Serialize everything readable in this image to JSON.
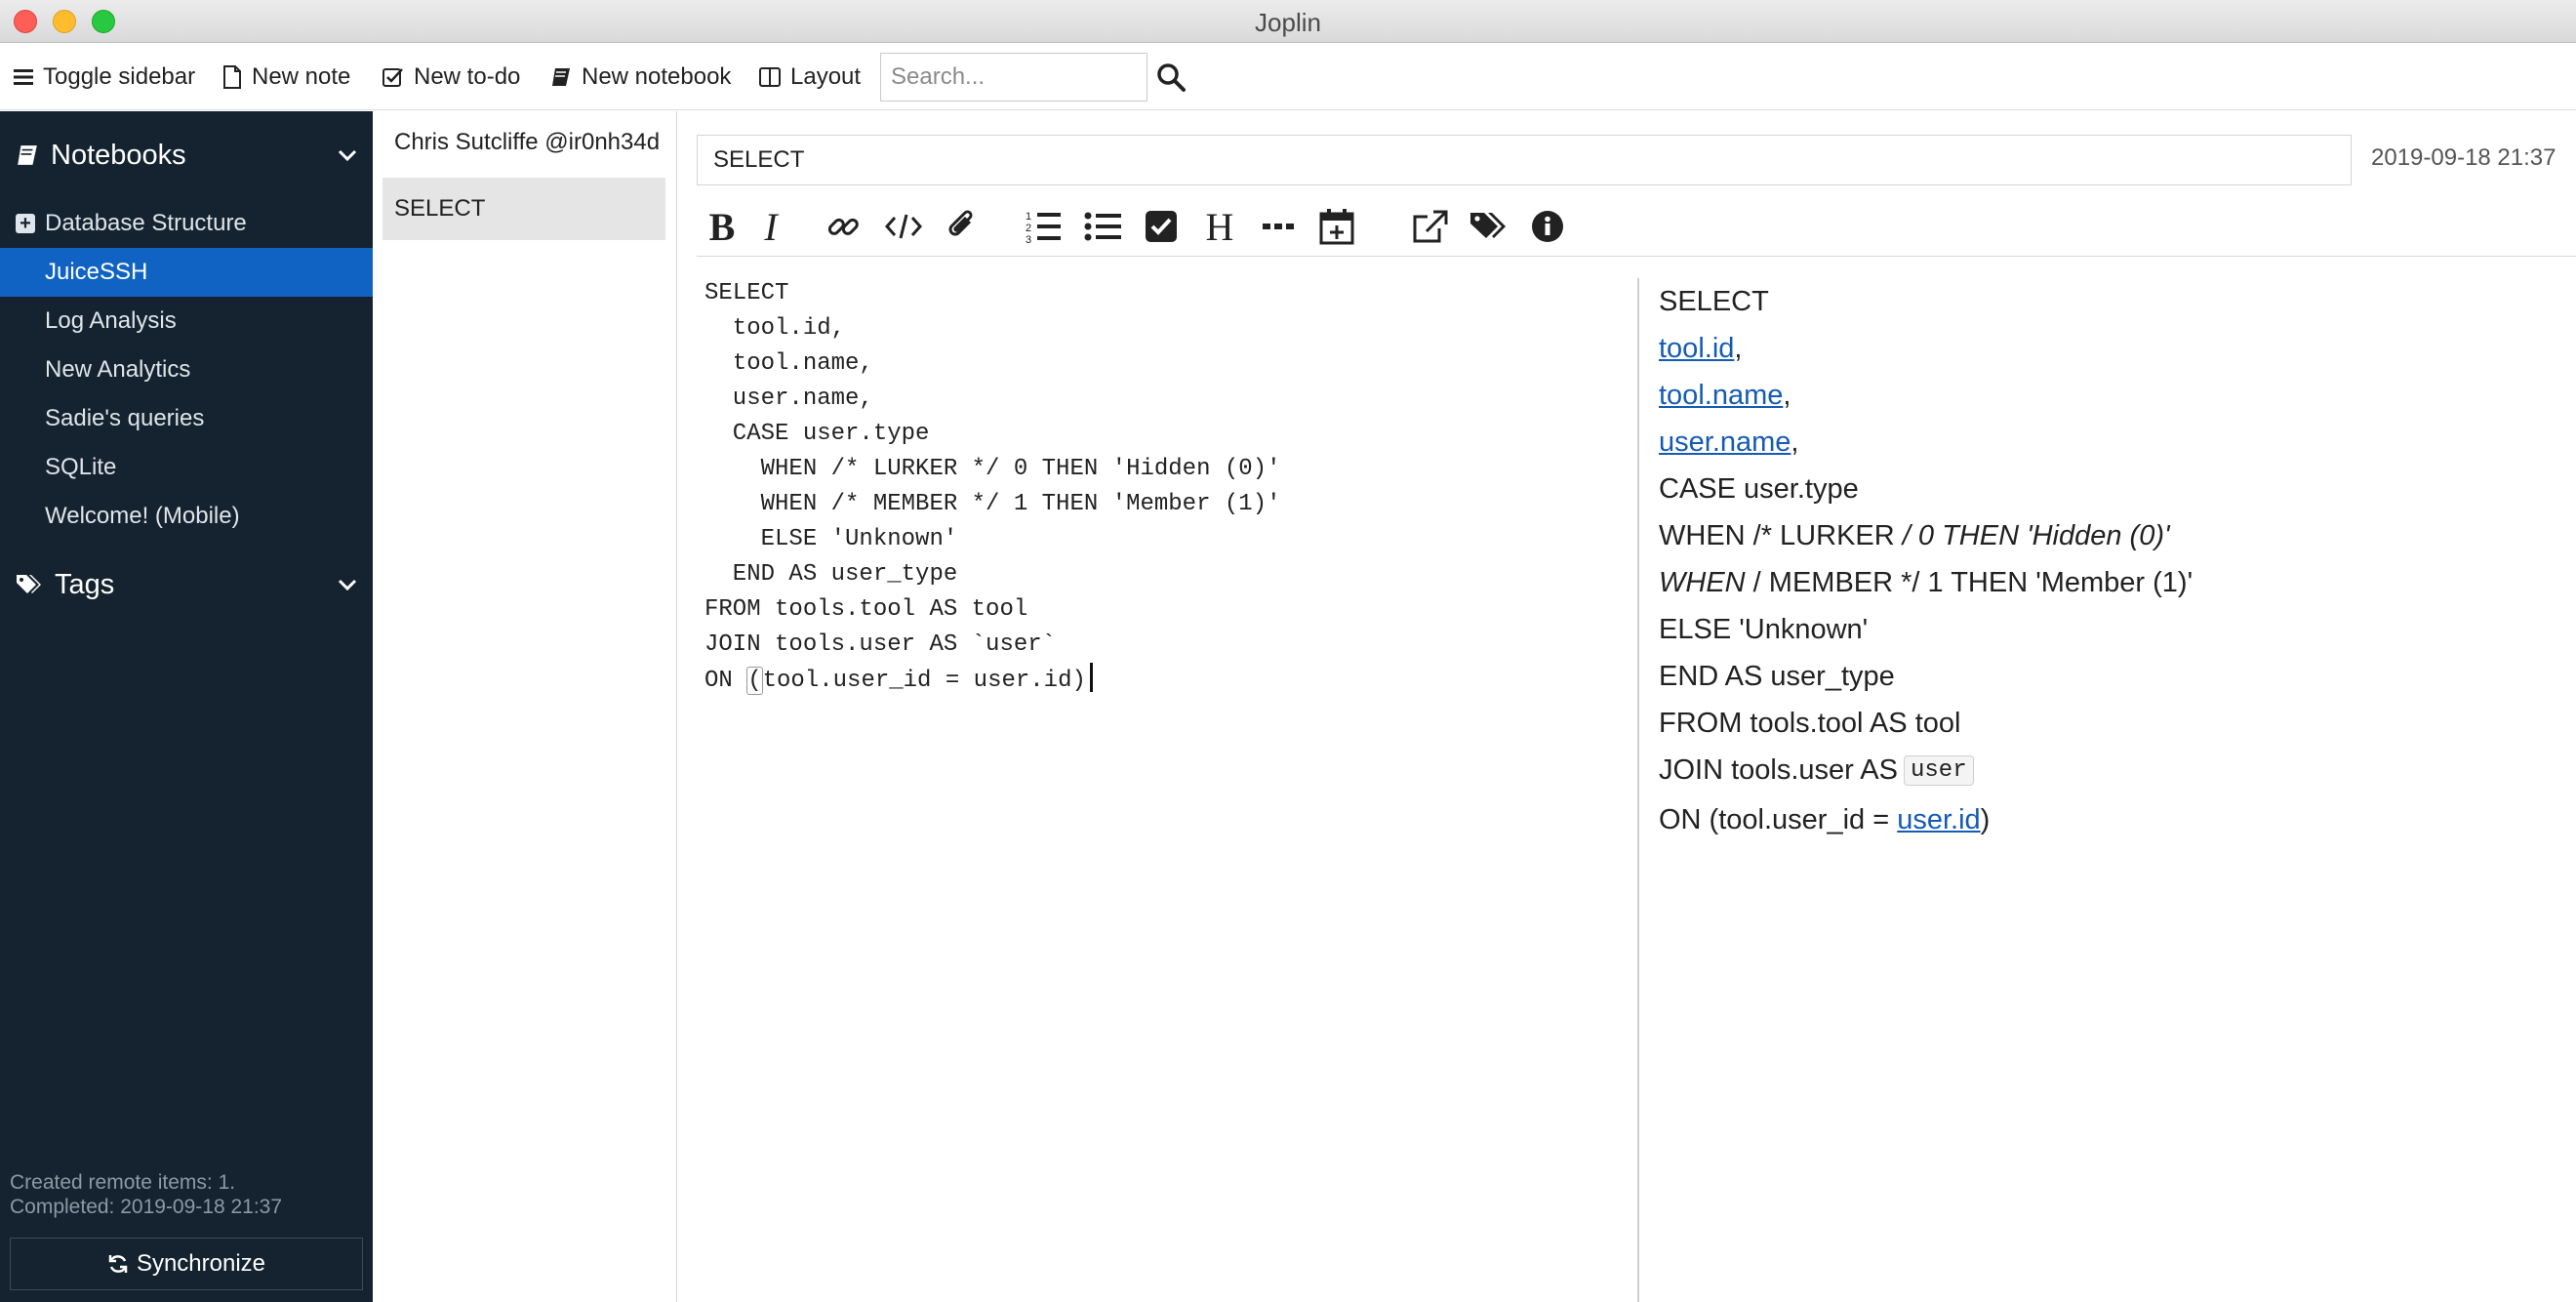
{
  "window": {
    "title": "Joplin"
  },
  "toolbar": {
    "toggle_sidebar": "Toggle sidebar",
    "new_note": "New note",
    "new_todo": "New to-do",
    "new_notebook": "New notebook",
    "layout": "Layout",
    "search_placeholder": "Search..."
  },
  "sidebar": {
    "notebooks_label": "Notebooks",
    "parent_notebook": "Database Structure",
    "notebooks": [
      "JuiceSSH",
      "Log Analysis",
      "New Analytics",
      "Sadie's queries",
      "SQLite",
      "Welcome! (Mobile)"
    ],
    "selected_notebook": "JuiceSSH",
    "tags_label": "Tags",
    "sync_status_line1": "Created remote items: 1.",
    "sync_status_line2": "Completed: 2019-09-18 21:37",
    "sync_button": "Synchronize"
  },
  "note_list": {
    "items": [
      "Chris Sutcliffe @ir0nh34d",
      "SELECT"
    ],
    "selected": "SELECT"
  },
  "note": {
    "title": "SELECT",
    "updated": "2019-09-18 21:37",
    "code_lines": [
      "SELECT",
      "  tool.id,",
      "  tool.name,",
      "  user.name,",
      "  CASE user.type",
      "    WHEN /* LURKER */ 0 THEN 'Hidden (0)'",
      "    WHEN /* MEMBER */ 1 THEN 'Member (1)'",
      "    ELSE 'Unknown'",
      "  END AS user_type",
      "FROM tools.tool AS tool",
      "JOIN tools.user AS `user`"
    ],
    "code_last": {
      "prefix": "ON ",
      "bracket": "(",
      "rest": "tool.user_id = user.id)"
    },
    "preview": {
      "l1": "SELECT",
      "l2_link": "tool.id",
      "l2_tail": ",",
      "l3_link": "tool.name",
      "l3_tail": ",",
      "l4_link": "user.name",
      "l4_tail": ",",
      "l5": "CASE user.type",
      "l6_a": "WHEN /* LURKER ",
      "l6_b": "/ 0 THEN 'Hidden (0)'",
      "l7_a": "WHEN ",
      "l7_b": "/ MEMBER */ 1 THEN 'Member (1)'",
      "l8": "ELSE 'Unknown'",
      "l9": "END AS user_type",
      "l10": "FROM tools.tool AS tool",
      "l11_a": "JOIN tools.user AS",
      "l11_code": "user",
      "l12_a": "ON (tool.user_id = ",
      "l12_link": "user.id",
      "l12_tail": ")"
    }
  },
  "icons": {
    "toolbar": [
      "bars-icon",
      "file-icon",
      "check-square-icon",
      "book-icon",
      "columns-icon",
      "search-icon"
    ],
    "markdown": [
      "bold-icon",
      "italic-icon",
      "link-icon",
      "code-icon",
      "paperclip-icon",
      "ordered-list-icon",
      "bullet-list-icon",
      "checkbox-icon",
      "heading-icon",
      "horizontal-rule-icon",
      "insert-date-icon",
      "external-editor-icon",
      "tags-icon",
      "info-icon"
    ]
  },
  "colors": {
    "sidebar_bg": "#14232f",
    "selected_bg": "#1063c2",
    "link": "#155bb5"
  }
}
